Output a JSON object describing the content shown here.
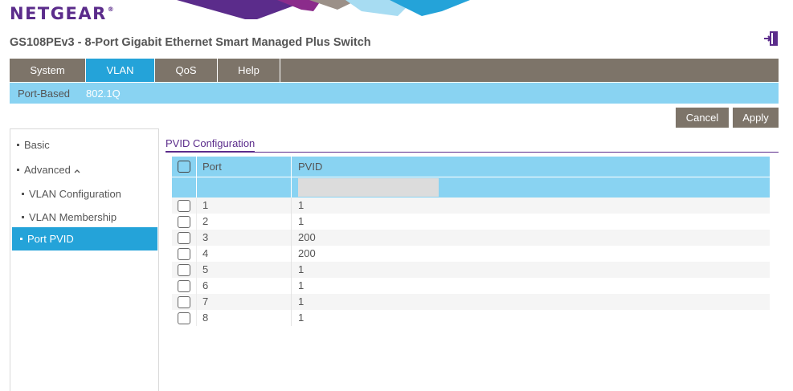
{
  "header": {
    "brand": "NETGEAR",
    "brand_mark": "®",
    "product_title": "GS108PEv3 - 8-Port Gigabit Ethernet Smart Managed Plus Switch",
    "logout_icon": "logout-icon"
  },
  "main_nav": {
    "tabs": [
      {
        "label": "System",
        "active": false
      },
      {
        "label": "VLAN",
        "active": true
      },
      {
        "label": "QoS",
        "active": false
      },
      {
        "label": "Help",
        "active": false
      }
    ]
  },
  "sub_nav": {
    "items": [
      {
        "label": "Port-Based",
        "active": false
      },
      {
        "label": "802.1Q",
        "active": true
      }
    ]
  },
  "actions": {
    "cancel_label": "Cancel",
    "apply_label": "Apply"
  },
  "sidebar": {
    "items": [
      {
        "label": "Basic",
        "level": 1
      },
      {
        "label": "Advanced",
        "level": 1,
        "expanded": true
      },
      {
        "label": "VLAN Configuration",
        "level": 2
      },
      {
        "label": "VLAN Membership",
        "level": 2
      },
      {
        "label": "Port PVID",
        "level": 2,
        "active": true
      }
    ],
    "expand_icon": "chevron-up-icon"
  },
  "content": {
    "section_title": "PVID Configuration",
    "columns": {
      "port": "Port",
      "pvid": "PVID"
    },
    "filter_value": "",
    "rows": [
      {
        "port": "1",
        "pvid": "1"
      },
      {
        "port": "2",
        "pvid": "1"
      },
      {
        "port": "3",
        "pvid": "200"
      },
      {
        "port": "4",
        "pvid": "200"
      },
      {
        "port": "5",
        "pvid": "1"
      },
      {
        "port": "6",
        "pvid": "1"
      },
      {
        "port": "7",
        "pvid": "1"
      },
      {
        "port": "8",
        "pvid": "1"
      }
    ]
  },
  "colors": {
    "brand_purple": "#5b2c8b",
    "nav_gray": "#7d7469",
    "accent_blue": "#24a3d9",
    "light_blue": "#89d3f2"
  }
}
